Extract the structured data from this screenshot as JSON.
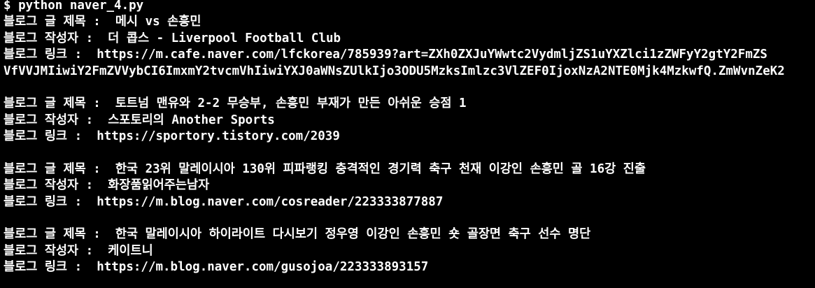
{
  "terminal": {
    "command": "$ python naver_4.py",
    "title_prefix": "블로그 글 제목 :  ",
    "author_prefix": "블로그 작성자 :  ",
    "link_prefix": "블로그 링크 :  ",
    "results": [
      {
        "title": "메시 vs 손흥민",
        "author": "더 콥스 - Liverpool Football Club",
        "link": "https://m.cafe.naver.com/lfckorea/785939?art=ZXh0ZXJuYWwtc2VydmljZS1uYXZlci1zZWFyY2gtY2FmZS",
        "link_cont": "VfVVJMIiwiY2FmZVVybCI6ImxmY2tvcmVhIiwiYXJ0aWNsZUlkIjo3ODU5MzksImlzc3VlZEF0IjoxNzA2NTE0Mjk4MzkwfQ.ZmWvnZeK2"
      },
      {
        "title": "토트넘 맨유와 2-2 무승부, 손흥민 부재가 만든 아쉬운 승점 1",
        "author": "스포토리의 Another Sports",
        "link": "https://sportory.tistory.com/2039"
      },
      {
        "title": "한국 23위 말레이시아 130위 피파랭킹 충격적인 경기력 축구 천재 이강인 손흥민 골 16강 진출",
        "author": "화장품읽어주는남자",
        "link": "https://m.blog.naver.com/cosreader/223333877887"
      },
      {
        "title": "한국 말레이시아 하이라이트 다시보기 정우영 이강인 손흥민 숏 골장면 축구 선수 명단",
        "author": "케이트니",
        "link": "https://m.blog.naver.com/gusojoa/223333893157"
      }
    ]
  },
  "colors": {
    "background": "#000000",
    "text": "#ffffff"
  }
}
